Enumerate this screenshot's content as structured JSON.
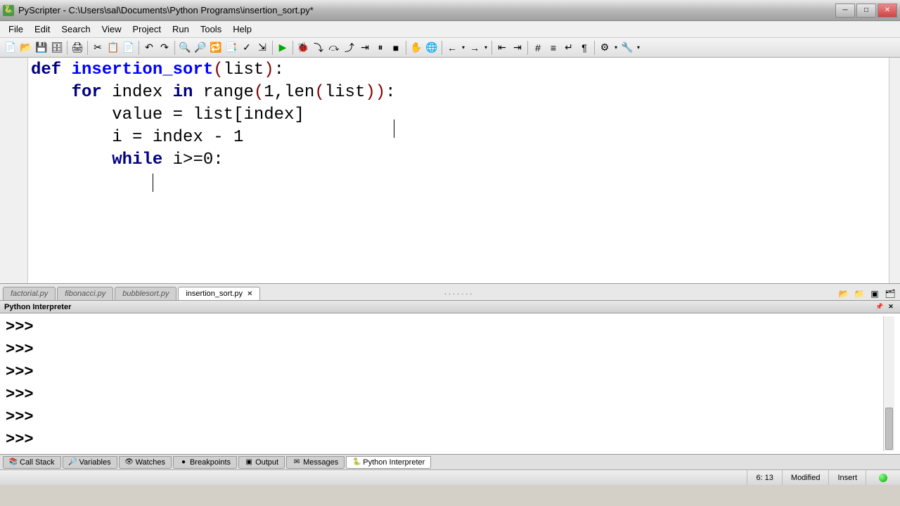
{
  "window": {
    "title": "PyScripter - C:\\Users\\sal\\Documents\\Python Programs\\insertion_sort.py*"
  },
  "menubar": {
    "items": [
      "File",
      "Edit",
      "Search",
      "View",
      "Project",
      "Run",
      "Tools",
      "Help"
    ]
  },
  "toolbar": {
    "groups": [
      [
        "new-file",
        "open-file",
        "save-file",
        "save-all"
      ],
      [
        "print"
      ],
      [
        "cut",
        "copy",
        "paste"
      ],
      [
        "undo",
        "redo"
      ],
      [
        "find",
        "find-next",
        "replace",
        "find-in-files"
      ],
      [
        "syntax-check",
        "import-module"
      ],
      [
        "run",
        "debug",
        "step-into",
        "step-over",
        "step-out",
        "run-to-cursor",
        "pause",
        "stop"
      ],
      [
        "toggle-breakpoint",
        "clear-breakpoints"
      ],
      [
        "nav-back",
        "nav-forward"
      ],
      [
        "outdent",
        "indent"
      ],
      [
        "comment",
        "uncomment",
        "toggle-comment",
        "toggle-whitespace"
      ],
      [
        "config",
        "tools-config"
      ]
    ]
  },
  "editor": {
    "lines": [
      {
        "indent": 0,
        "tokens": [
          [
            "kw",
            "def "
          ],
          [
            "fn",
            "insertion_sort"
          ],
          [
            "paren",
            "("
          ],
          [
            "builtin",
            "list"
          ],
          [
            "paren",
            ")"
          ],
          [
            "plain",
            ":"
          ]
        ]
      },
      {
        "indent": 1,
        "tokens": [
          [
            "kw",
            "for"
          ],
          [
            "plain",
            " index "
          ],
          [
            "kw",
            "in"
          ],
          [
            "plain",
            " "
          ],
          [
            "builtin",
            "range"
          ],
          [
            "paren",
            "("
          ],
          [
            "num",
            "1"
          ],
          [
            "plain",
            ","
          ],
          [
            "builtin",
            "len"
          ],
          [
            "paren",
            "("
          ],
          [
            "builtin",
            "list"
          ],
          [
            "paren",
            "))"
          ],
          [
            "plain",
            ":"
          ]
        ]
      },
      {
        "indent": 2,
        "tokens": [
          [
            "plain",
            "value = "
          ],
          [
            "builtin",
            "list"
          ],
          [
            "plain",
            "[index]"
          ]
        ]
      },
      {
        "indent": 2,
        "tokens": [
          [
            "plain",
            "i = index - "
          ],
          [
            "num",
            "1"
          ]
        ]
      },
      {
        "indent": 2,
        "tokens": [
          [
            "kw",
            "while"
          ],
          [
            "plain",
            " i>="
          ],
          [
            "num",
            "0"
          ],
          [
            "plain",
            ":"
          ]
        ]
      },
      {
        "indent": 3,
        "tokens": []
      }
    ]
  },
  "tabs": {
    "items": [
      {
        "label": "factorial.py",
        "active": false
      },
      {
        "label": "fibonacci.py",
        "active": false
      },
      {
        "label": "bubblesort.py",
        "active": false
      },
      {
        "label": "insertion_sort.py",
        "active": true
      }
    ]
  },
  "interpreter": {
    "title": "Python Interpreter",
    "prompts": [
      ">>>",
      ">>>",
      ">>>",
      ">>>",
      ">>>",
      ">>>"
    ]
  },
  "bottom_tabs": {
    "items": [
      {
        "icon": "📚",
        "label": "Call Stack"
      },
      {
        "icon": "🔎",
        "label": "Variables"
      },
      {
        "icon": "👁",
        "label": "Watches"
      },
      {
        "icon": "●",
        "label": "Breakpoints"
      },
      {
        "icon": "▣",
        "label": "Output"
      },
      {
        "icon": "✉",
        "label": "Messages"
      },
      {
        "icon": "🐍",
        "label": "Python Interpreter",
        "active": true
      }
    ]
  },
  "statusbar": {
    "position": "6: 13",
    "modified": "Modified",
    "insert_mode": "Insert"
  }
}
